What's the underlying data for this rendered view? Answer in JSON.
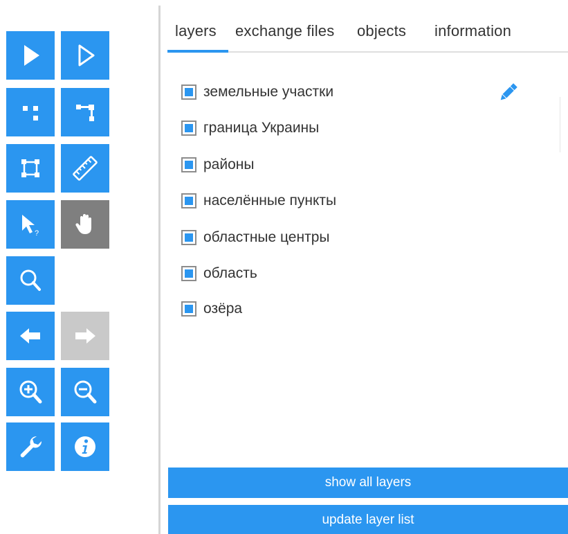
{
  "toolbar": {
    "tools": [
      {
        "icon": "arrow-select-icon",
        "state": "normal"
      },
      {
        "icon": "arrow-outline-select-icon",
        "state": "normal"
      },
      {
        "icon": "vertex-points-icon",
        "state": "normal"
      },
      {
        "icon": "vertex-line-icon",
        "state": "normal"
      },
      {
        "icon": "bounding-box-icon",
        "state": "normal"
      },
      {
        "icon": "ruler-icon",
        "state": "normal"
      },
      {
        "icon": "identify-cursor-icon",
        "state": "normal"
      },
      {
        "icon": "hand-pan-icon",
        "state": "active"
      },
      {
        "icon": "magnifier-icon",
        "state": "normal"
      },
      {
        "icon": "arrow-left-icon",
        "state": "normal"
      },
      {
        "icon": "arrow-right-icon",
        "state": "disabled"
      },
      {
        "icon": "zoom-in-icon",
        "state": "normal"
      },
      {
        "icon": "zoom-out-icon",
        "state": "normal"
      },
      {
        "icon": "wrench-icon",
        "state": "normal"
      },
      {
        "icon": "info-icon",
        "state": "normal"
      }
    ]
  },
  "tabs": [
    {
      "label": "layers",
      "active": true
    },
    {
      "label": "exchange files",
      "active": false
    },
    {
      "label": "objects",
      "active": false
    },
    {
      "label": "information",
      "active": false
    }
  ],
  "layers": [
    {
      "label": "земельные участки",
      "checked": true
    },
    {
      "label": "граница Украины",
      "checked": true
    },
    {
      "label": "районы",
      "checked": true
    },
    {
      "label": "населённые пункты",
      "checked": true
    },
    {
      "label": "областные центры",
      "checked": true
    },
    {
      "label": "область",
      "checked": true
    },
    {
      "label": "озёра",
      "checked": true
    }
  ],
  "buttons": {
    "show_all": "show all layers",
    "update": "update layer list"
  },
  "colors": {
    "accent": "#2b96f0",
    "active_tool": "#7f7f7f",
    "disabled_tool": "#c9c9c9"
  }
}
